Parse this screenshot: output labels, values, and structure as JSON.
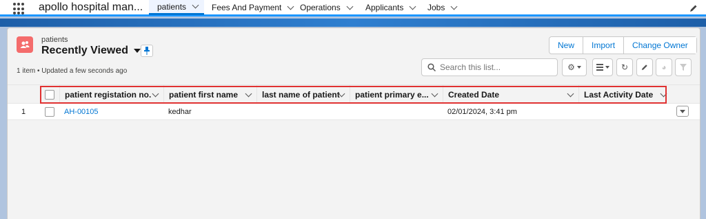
{
  "app": {
    "name": "apollo hospital man..."
  },
  "nav": {
    "tabs": [
      {
        "label": "patients",
        "active": true
      },
      {
        "label": "Fees And Payment",
        "active": false
      },
      {
        "label": "Operations",
        "active": false
      },
      {
        "label": "Applicants",
        "active": false
      },
      {
        "label": "Jobs",
        "active": false
      }
    ]
  },
  "list": {
    "object_label": "patients",
    "view_title": "Recently Viewed",
    "meta": "1 item • Updated a few seconds ago",
    "buttons": {
      "new": "New",
      "import": "Import",
      "change_owner": "Change Owner"
    },
    "search_placeholder": "Search this list..."
  },
  "table": {
    "columns": [
      "patient registation no.",
      "patient first name",
      "last name of patient",
      "patient primary e...",
      "Created Date",
      "Last Activity Date"
    ],
    "rows": [
      {
        "num": "1",
        "reg_no": "AH-00105",
        "first_name": "kedhar",
        "last_name": "",
        "email": "",
        "created": "02/01/2024, 3:41 pm",
        "last_activity": ""
      }
    ]
  },
  "colors": {
    "accent": "#0176d3",
    "highlight": "#e03131",
    "object_icon": "#f46c6c"
  }
}
